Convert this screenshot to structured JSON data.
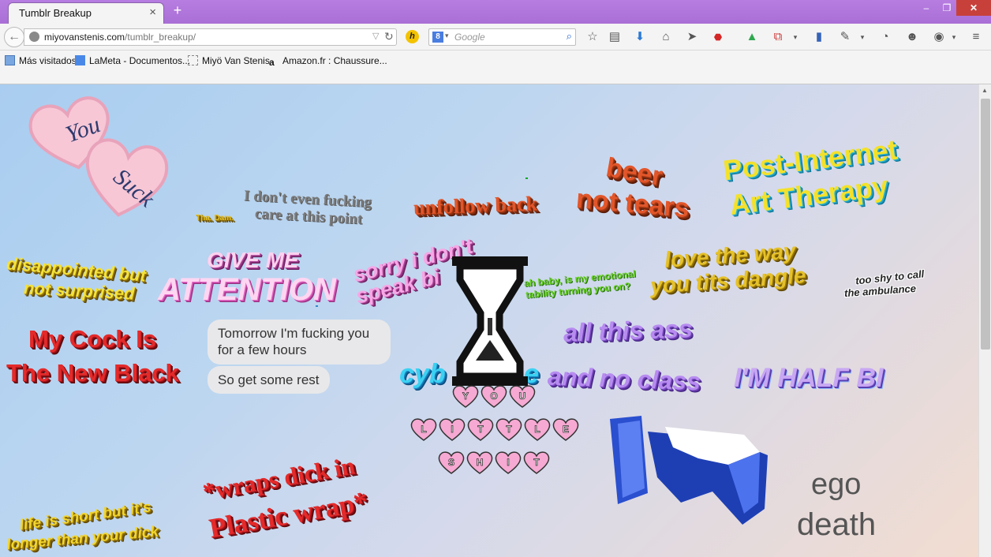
{
  "browser": {
    "tab_title": "Tumblr Breakup",
    "tab_close": "×",
    "new_tab": "+",
    "win_min": "–",
    "win_max": "❐",
    "win_close": "✕",
    "url_domain": "miyovanstenis.com",
    "url_path": "/tumblr_breakup/",
    "search_placeholder": "Google",
    "search_engine": "8"
  },
  "bookmarks": [
    {
      "label": "Más visitados",
      "icon": "bookmark-folder-icon"
    },
    {
      "label": "LaMeta - Documentos...",
      "icon": "docs-icon"
    },
    {
      "label": "Miyö Van Stenis",
      "icon": "page-icon"
    },
    {
      "label": "Amazon.fr : Chaussure...",
      "icon": "amazon-icon"
    }
  ],
  "stickers": {
    "heart1": "You",
    "heart2": "Suck",
    "small_yellow": "Tha. Dam.",
    "dont_care_1": "I don't even fucking",
    "dont_care_2": "care at this point",
    "unfollow": "unfollow back",
    "beer": "beer",
    "not_tears": "not tears",
    "post_internet_1": "Post-Internet",
    "post_internet_2": "Art Therapy",
    "disappointed_1": "disappointed but",
    "disappointed_2": "not surprised",
    "give_me": "GIVE ME",
    "attention": "ATTENTION",
    "sorry_1": "sorry i don't",
    "sorry_2": "speak bi",
    "ooh_1": "ah baby, is my emotional",
    "ooh_2": "tability turning you on?",
    "love_way_1": "love the way",
    "love_way_2": "you tits dangle",
    "too_shy_1": "too shy to call",
    "too_shy_2": "the ambulance",
    "cock_1": "My Cock Is",
    "cock_2": "The New Black",
    "chat_1": "Tomorrow I'm fucking you for a few hours",
    "chat_2": "So get some rest",
    "cyber": "cyb",
    "cyber_end": "e",
    "all_this": "all this ass",
    "no_class": "and no class",
    "half_bi": "I'M HALF BI",
    "life_short_1": "life is short but it's",
    "life_short_2": "longer than your dick",
    "wraps_1": "*wraps dick in",
    "wraps_2": "Plastic wrap*",
    "hearts_row1": [
      "Y",
      "O",
      "U"
    ],
    "hearts_row2": [
      "L",
      "I",
      "T",
      "T",
      "L",
      "E"
    ],
    "hearts_row3": [
      "S",
      "H",
      "I",
      "T"
    ],
    "ego": "ego",
    "death": "death"
  },
  "colors": {
    "titlebar": "#b77de0",
    "close_button": "#c7413a",
    "heart_pink": "#f6a9d2"
  }
}
